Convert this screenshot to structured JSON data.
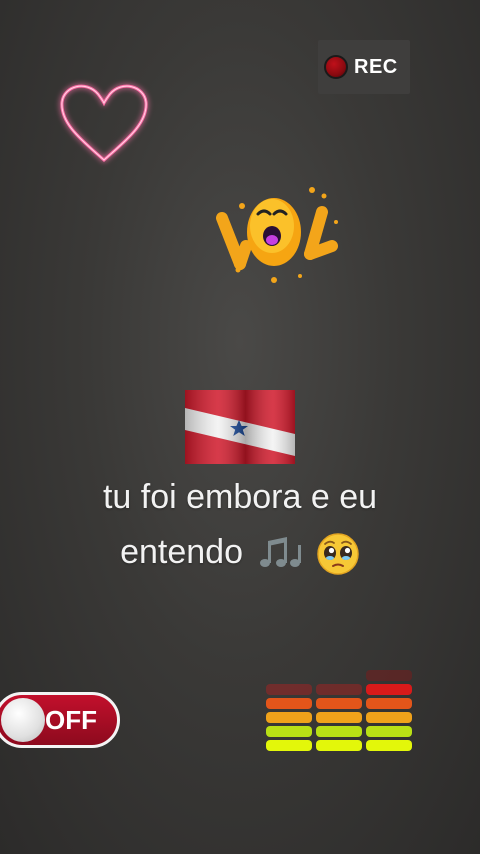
{
  "rec": {
    "label": "REC",
    "dot_color": "#c0101a"
  },
  "caption": {
    "line1": "tu foi embora e eu",
    "line2": "entendo"
  },
  "emojis": {
    "notes": "musical-notes-icon",
    "face": "pleading-face-icon"
  },
  "toggle": {
    "label": "OFF",
    "state": "off",
    "color": "#b00e27"
  },
  "equalizer": {
    "columns": [
      {
        "lit_bars": 4
      },
      {
        "lit_bars": 4
      },
      {
        "lit_bars": 5
      }
    ],
    "colors": [
      "#e3f70a",
      "#b9e015",
      "#f0a21a",
      "#e3551a",
      "#d81a1a",
      "#9a1010"
    ]
  },
  "colors": {
    "heart_neon": "#ff6fa8",
    "caption_text": "#f2f2f2"
  }
}
